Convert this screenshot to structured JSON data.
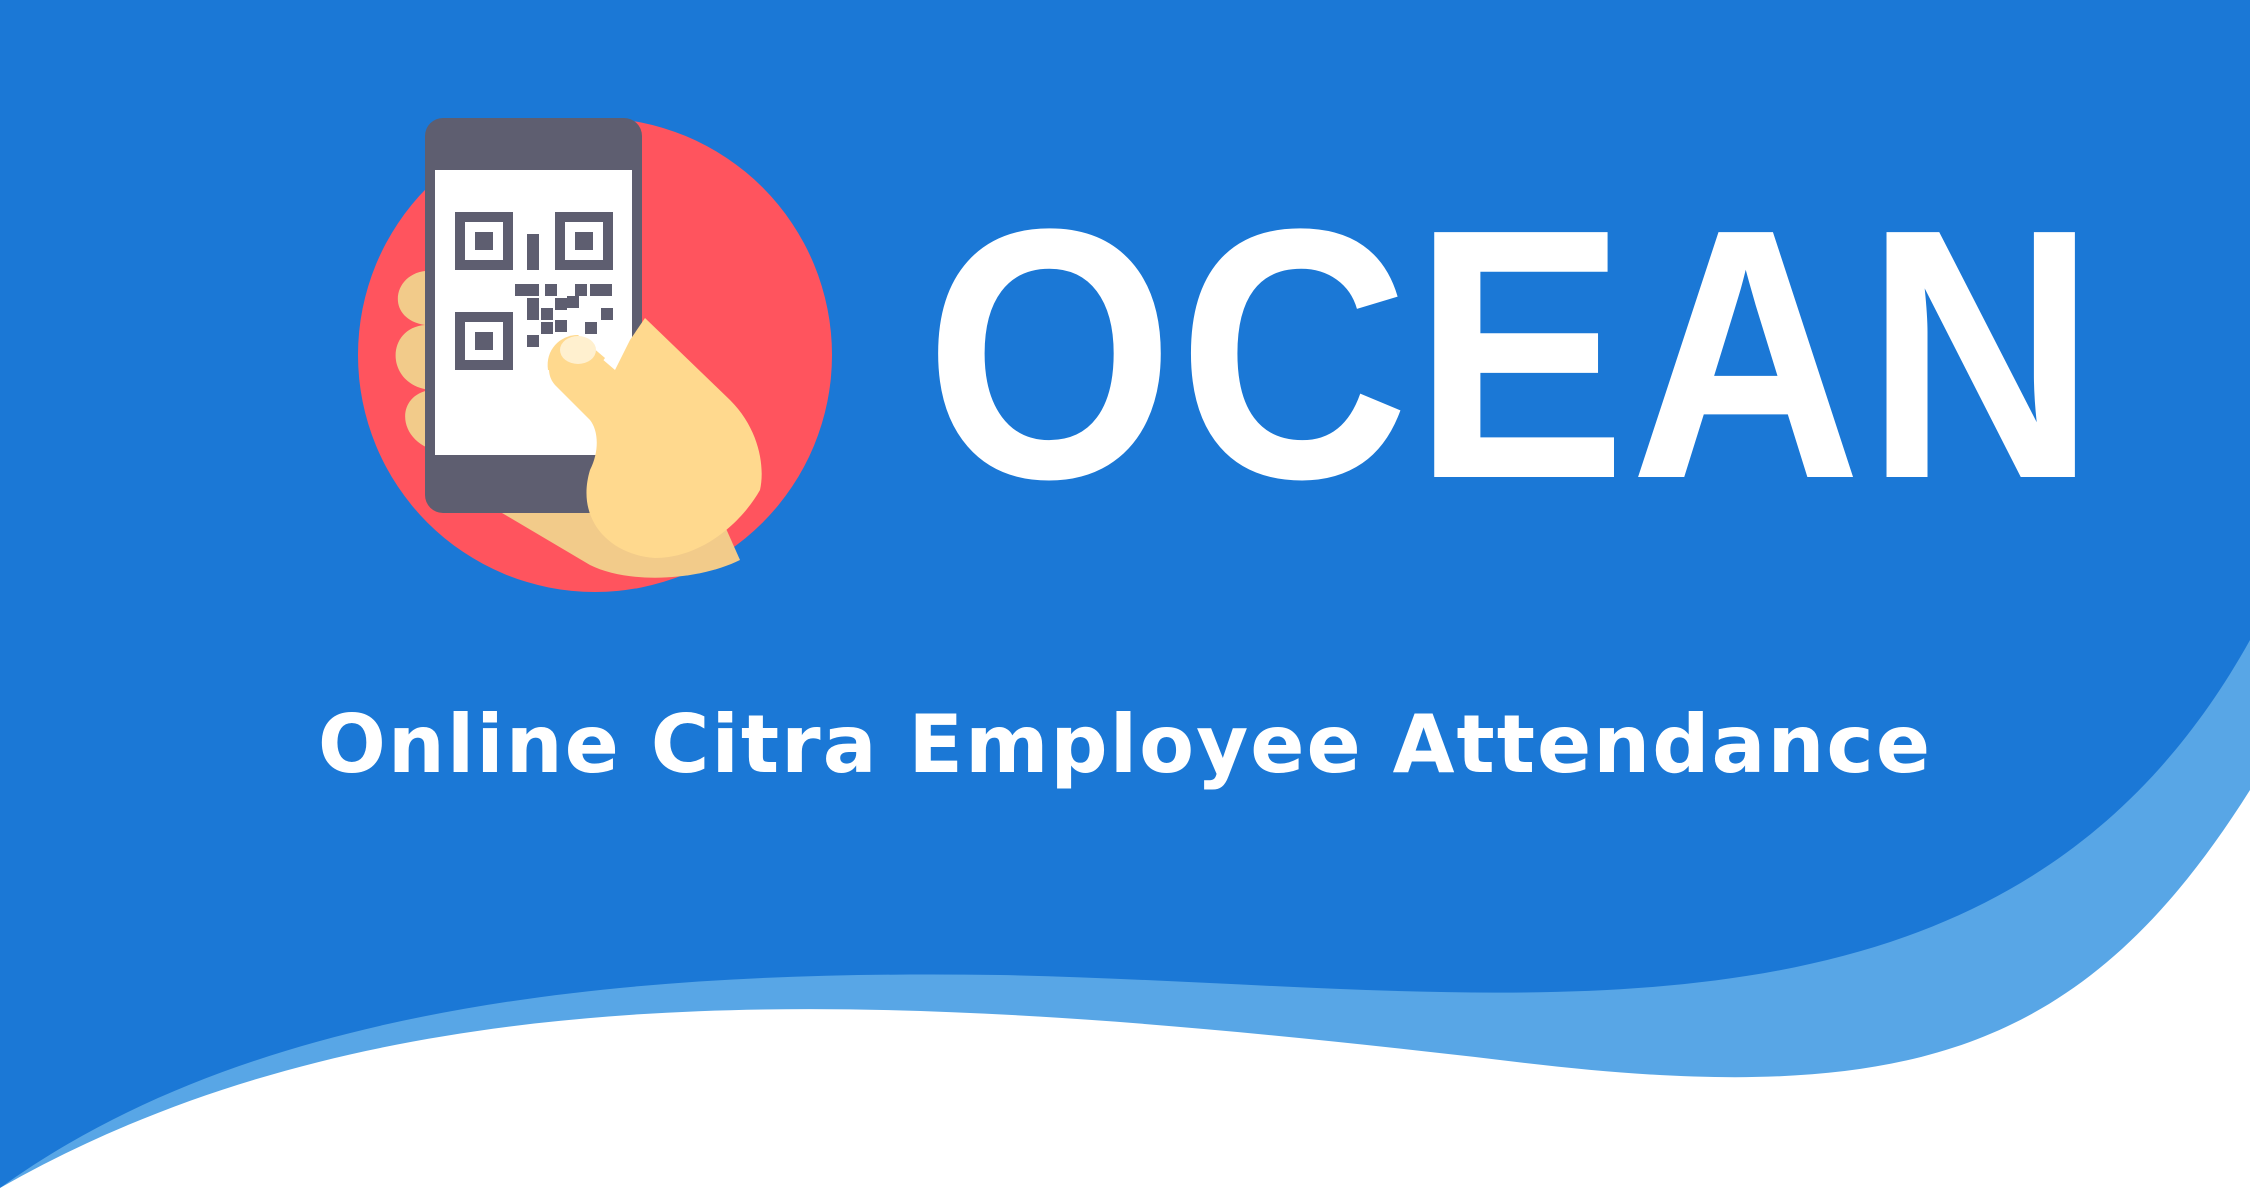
{
  "banner": {
    "title": "OCEAN",
    "subtitle": "Online Citra Employee Attendance",
    "illustration": "phone-qr-scan-icon"
  },
  "colors": {
    "background": "#1b78d6",
    "wave_light": "#58a6e6",
    "wave_white": "#ffffff",
    "circle": "#ff545e",
    "phone_body": "#5e5e70",
    "phone_screen": "#ffffff",
    "qr_code": "#5e5e70",
    "hand": "#ffd98e",
    "hand_shadow": "#f2cb8a",
    "text": "#ffffff"
  }
}
